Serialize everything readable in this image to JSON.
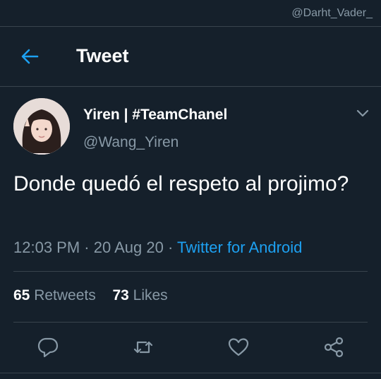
{
  "watermark": "@Darht_Vader_",
  "header": {
    "title": "Tweet"
  },
  "tweet": {
    "display_name": "Yiren | #TeamChanel",
    "handle": "@Wang_Yiren",
    "text": "Donde quedó el respeto al projimo?",
    "time": "12:03 PM",
    "separator": "·",
    "date": "20 Aug 20",
    "source": "Twitter for Android",
    "retweets_count": "65",
    "retweets_label": "Retweets",
    "likes_count": "73",
    "likes_label": "Likes"
  },
  "icons": {
    "back": "arrow-left-icon",
    "caret": "chevron-down-icon",
    "reply": "reply-icon",
    "retweet": "retweet-icon",
    "like": "heart-icon",
    "share": "share-icon"
  },
  "colors": {
    "background": "#15202b",
    "accent": "#1da1f2",
    "secondary_text": "#8899a6",
    "divider": "#38444d"
  }
}
